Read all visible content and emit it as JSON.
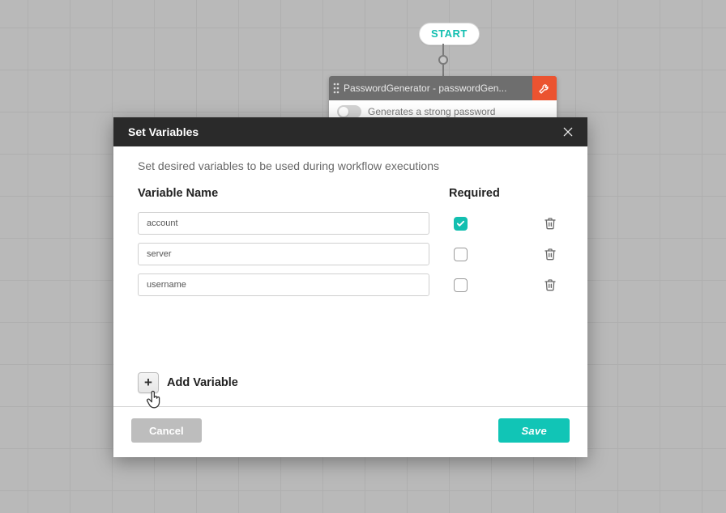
{
  "canvas": {
    "start_label": "START",
    "node": {
      "title": "PasswordGenerator - passwordGen...",
      "description": "Generates a strong password"
    }
  },
  "modal": {
    "title": "Set Variables",
    "description": "Set desired variables to be used during workflow executions",
    "columns": {
      "name": "Variable Name",
      "required": "Required"
    },
    "rows": [
      {
        "name": "account",
        "required": true
      },
      {
        "name": "server",
        "required": false
      },
      {
        "name": "username",
        "required": false
      }
    ],
    "add_label": "Add Variable",
    "buttons": {
      "cancel": "Cancel",
      "save": "Save"
    }
  }
}
